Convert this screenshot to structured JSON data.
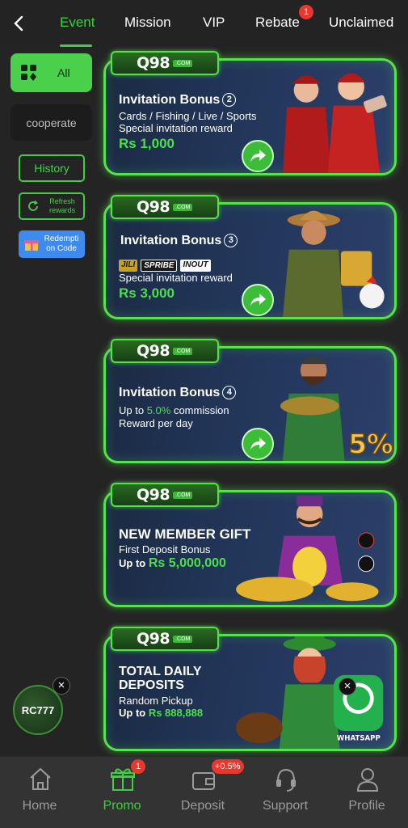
{
  "tabs": [
    {
      "label": "Event",
      "active": true
    },
    {
      "label": "Mission"
    },
    {
      "label": "VIP"
    },
    {
      "label": "Rebate",
      "badge": "1"
    },
    {
      "label": "Unclaimed"
    }
  ],
  "sidebar": {
    "all": "All",
    "cooperate": "cooperate",
    "history": "History",
    "refresh": "Refresh rewards",
    "redeem": "Redempti on Code"
  },
  "brand": {
    "logo": "Q98",
    "com": ".COM"
  },
  "cards": [
    {
      "title": "Invitation Bonus",
      "num": "2",
      "sub1": "Cards / Fishing / Live / Sports",
      "sub2": "Special invitation reward",
      "amount": "Rs 1,000"
    },
    {
      "title": "Invitation Bonus",
      "num": "3",
      "providers": [
        "JILI",
        "SPRIBE",
        "INOUT"
      ],
      "sub2": "Special invitation reward",
      "amount": "Rs 3,000"
    },
    {
      "title": "Invitation Bonus",
      "num": "4",
      "sub1_pre": "Up to ",
      "sub1_hl": "5.0%",
      "sub1_post": " commission",
      "sub2": "Reward per day",
      "art_text": "5%"
    },
    {
      "title": "NEW MEMBER GIFT",
      "sub1": "First Deposit Bonus",
      "amount_pre": "Up to ",
      "amount": "Rs 5,000,000"
    },
    {
      "title1": "TOTAL DAILY",
      "title2": "DEPOSITS",
      "sub1": "Random Pickup",
      "amount_pre": "Up to ",
      "amount": "Rs 888,888",
      "art_text": "WHATSAPP"
    }
  ],
  "float": {
    "rc": "RC777"
  },
  "bottom_nav": [
    {
      "label": "Home",
      "icon": "home-icon"
    },
    {
      "label": "Promo",
      "icon": "gift-icon",
      "active": true,
      "badge": "1"
    },
    {
      "label": "Deposit",
      "icon": "wallet-icon",
      "badge": "+0.5%"
    },
    {
      "label": "Support",
      "icon": "headset-icon"
    },
    {
      "label": "Profile",
      "icon": "user-icon"
    }
  ],
  "colors": {
    "accent": "#39d23f",
    "badge": "#e8372d",
    "bg": "#242424"
  }
}
